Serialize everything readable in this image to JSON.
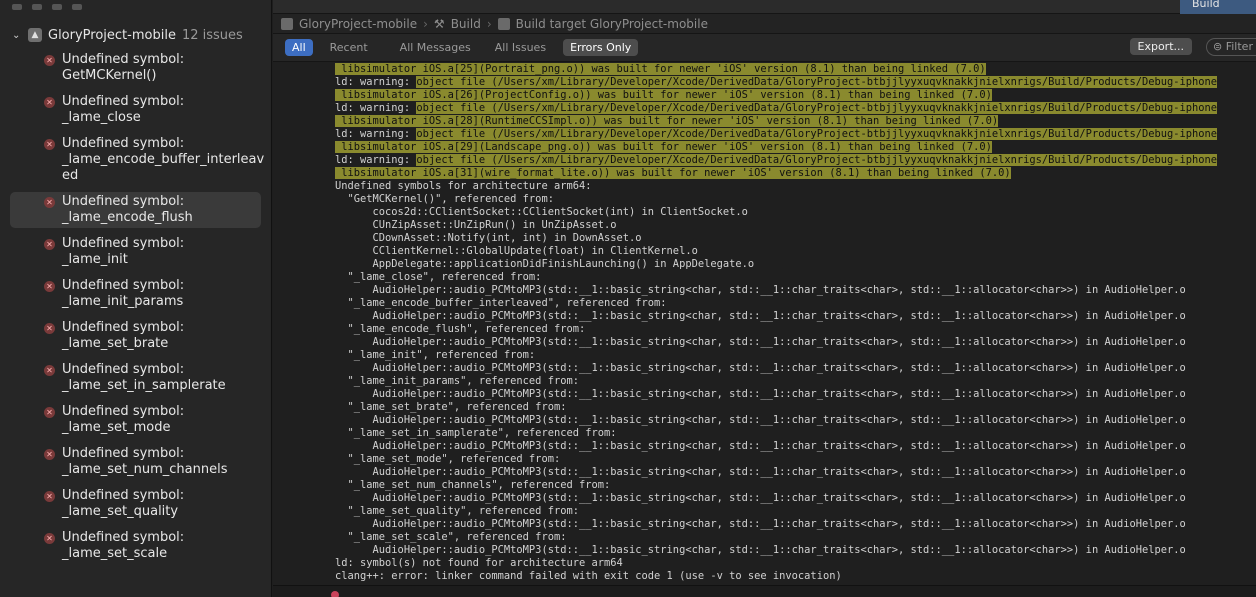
{
  "sidebar": {
    "project": {
      "name": "GloryProject-mobile",
      "count": "12 issues"
    },
    "issues": [
      {
        "line1": "Undefined symbol:",
        "line2": "GetMCKernel()"
      },
      {
        "line1": "Undefined symbol:",
        "line2": "_lame_close"
      },
      {
        "line1": "Undefined symbol:",
        "line2": "_lame_encode_buffer_interleav",
        "line3": "ed"
      },
      {
        "line1": "Undefined symbol:",
        "line2": "_lame_encode_flush"
      },
      {
        "line1": "Undefined symbol: _lame_init"
      },
      {
        "line1": "Undefined symbol:",
        "line2": "_lame_init_params"
      },
      {
        "line1": "Undefined symbol:",
        "line2": "_lame_set_brate"
      },
      {
        "line1": "Undefined symbol:",
        "line2": "_lame_set_in_samplerate"
      },
      {
        "line1": "Undefined symbol:",
        "line2": "_lame_set_mode"
      },
      {
        "line1": "Undefined symbol:",
        "line2": "_lame_set_num_channels"
      },
      {
        "line1": "Undefined symbol:",
        "line2": "_lame_set_quality"
      },
      {
        "line1": "Undefined symbol:",
        "line2": "_lame_set_scale"
      }
    ],
    "selected_index": 3
  },
  "tabs": {
    "active": "Build"
  },
  "breadcrumb": {
    "project": "GloryProject-mobile",
    "sep": "›",
    "build": "Build",
    "target": "Build target GloryProject-mobile"
  },
  "filters": {
    "all": "All",
    "recent": "Recent",
    "all_messages": "All Messages",
    "all_issues": "All Issues",
    "errors_only": "Errors Only",
    "export": "Export...",
    "filter_placeholder": "Filter"
  },
  "log": [
    {
      "hl": true,
      "text": " libsimulator iOS.a[25](Portrait_png.o)) was built for newer 'iOS' version (8.1) than being linked (7.0)"
    },
    {
      "prefix": "ld: warning: ",
      "hl_text": "object file (/Users/xm/Library/Developer/Xcode/DerivedData/GloryProject-btbjjlyyxuqvknakkjnielxnrigs/Build/Products/Debug-iphone"
    },
    {
      "hl": true,
      "text": " libsimulator iOS.a[26](ProjectConfig.o)) was built for newer 'iOS' version (8.1) than being linked (7.0)"
    },
    {
      "prefix": "ld: warning: ",
      "hl_text": "object file (/Users/xm/Library/Developer/Xcode/DerivedData/GloryProject-btbjjlyyxuqvknakkjnielxnrigs/Build/Products/Debug-iphone"
    },
    {
      "hl": true,
      "text": " libsimulator iOS.a[28](RuntimeCCSImpl.o)) was built for newer 'iOS' version (8.1) than being linked (7.0)"
    },
    {
      "prefix": "ld: warning: ",
      "hl_text": "object file (/Users/xm/Library/Developer/Xcode/DerivedData/GloryProject-btbjjlyyxuqvknakkjnielxnrigs/Build/Products/Debug-iphone"
    },
    {
      "hl": true,
      "text": " libsimulator iOS.a[29](Landscape_png.o)) was built for newer 'iOS' version (8.1) than being linked (7.0)"
    },
    {
      "prefix": "ld: warning: ",
      "hl_text": "object file (/Users/xm/Library/Developer/Xcode/DerivedData/GloryProject-btbjjlyyxuqvknakkjnielxnrigs/Build/Products/Debug-iphone"
    },
    {
      "hl": true,
      "text": " libsimulator iOS.a[31](wire_format_lite.o)) was built for newer 'iOS' version (8.1) than being linked (7.0)"
    },
    {
      "text": "Undefined symbols for architecture arm64:"
    },
    {
      "text": "  \"GetMCKernel()\", referenced from:"
    },
    {
      "text": "      cocos2d::CClientSocket::CClientSocket(int) in ClientSocket.o"
    },
    {
      "text": "      CUnZipAsset::UnZipRun() in UnZipAsset.o"
    },
    {
      "text": "      CDownAsset::Notify(int, int) in DownAsset.o"
    },
    {
      "text": "      CClientKernel::GlobalUpdate(float) in ClientKernel.o"
    },
    {
      "text": "      AppDelegate::applicationDidFinishLaunching() in AppDelegate.o"
    },
    {
      "text": "  \"_lame_close\", referenced from:"
    },
    {
      "text": "      AudioHelper::audio_PCMtoMP3(std::__1::basic_string<char, std::__1::char_traits<char>, std::__1::allocator<char>>) in AudioHelper.o"
    },
    {
      "text": "  \"_lame_encode_buffer_interleaved\", referenced from:"
    },
    {
      "text": "      AudioHelper::audio_PCMtoMP3(std::__1::basic_string<char, std::__1::char_traits<char>, std::__1::allocator<char>>) in AudioHelper.o"
    },
    {
      "text": "  \"_lame_encode_flush\", referenced from:"
    },
    {
      "text": "      AudioHelper::audio_PCMtoMP3(std::__1::basic_string<char, std::__1::char_traits<char>, std::__1::allocator<char>>) in AudioHelper.o"
    },
    {
      "text": "  \"_lame_init\", referenced from:"
    },
    {
      "text": "      AudioHelper::audio_PCMtoMP3(std::__1::basic_string<char, std::__1::char_traits<char>, std::__1::allocator<char>>) in AudioHelper.o"
    },
    {
      "text": "  \"_lame_init_params\", referenced from:"
    },
    {
      "text": "      AudioHelper::audio_PCMtoMP3(std::__1::basic_string<char, std::__1::char_traits<char>, std::__1::allocator<char>>) in AudioHelper.o"
    },
    {
      "text": "  \"_lame_set_brate\", referenced from:"
    },
    {
      "text": "      AudioHelper::audio_PCMtoMP3(std::__1::basic_string<char, std::__1::char_traits<char>, std::__1::allocator<char>>) in AudioHelper.o"
    },
    {
      "text": "  \"_lame_set_in_samplerate\", referenced from:"
    },
    {
      "text": "      AudioHelper::audio_PCMtoMP3(std::__1::basic_string<char, std::__1::char_traits<char>, std::__1::allocator<char>>) in AudioHelper.o"
    },
    {
      "text": "  \"_lame_set_mode\", referenced from:"
    },
    {
      "text": "      AudioHelper::audio_PCMtoMP3(std::__1::basic_string<char, std::__1::char_traits<char>, std::__1::allocator<char>>) in AudioHelper.o"
    },
    {
      "text": "  \"_lame_set_num_channels\", referenced from:"
    },
    {
      "text": "      AudioHelper::audio_PCMtoMP3(std::__1::basic_string<char, std::__1::char_traits<char>, std::__1::allocator<char>>) in AudioHelper.o"
    },
    {
      "text": "  \"_lame_set_quality\", referenced from:"
    },
    {
      "text": "      AudioHelper::audio_PCMtoMP3(std::__1::basic_string<char, std::__1::char_traits<char>, std::__1::allocator<char>>) in AudioHelper.o"
    },
    {
      "text": "  \"_lame_set_scale\", referenced from:"
    },
    {
      "text": "      AudioHelper::audio_PCMtoMP3(std::__1::basic_string<char, std::__1::char_traits<char>, std::__1::allocator<char>>) in AudioHelper.o"
    },
    {
      "text": "ld: symbol(s) not found for architecture arm64"
    },
    {
      "text": "clang++: error: linker command failed with exit code 1 (use -v to see invocation)"
    }
  ],
  "icons": {
    "error": "error-x-icon",
    "disclosure": "chevron-down-icon",
    "project": "project-icon",
    "hammer": "hammer-icon",
    "filter": "filter-icon"
  }
}
